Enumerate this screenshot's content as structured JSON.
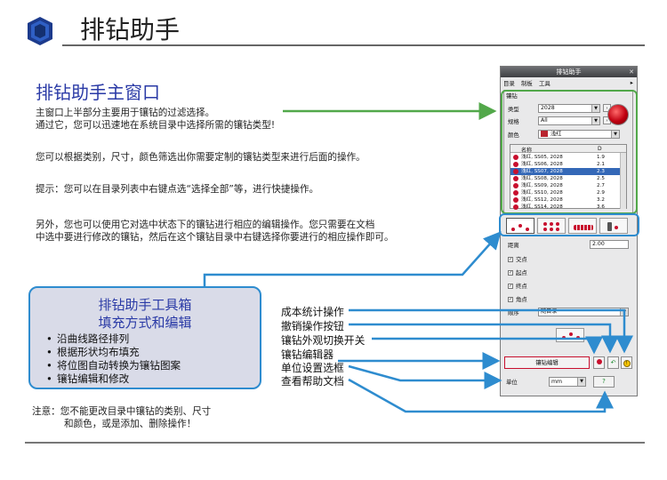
{
  "slide": {
    "title": "排钻助手",
    "section_heading": "排钻助手主窗口",
    "para1_line1": "主窗口上半部分主要用于镶钻的过滤选择。",
    "para1_line2": "通过它，您可以迅速地在系统目录中选择所需的镶钻类型!",
    "para2": "您可以根据类别，尺寸，颜色筛选出你需要定制的镶钻类型来进行后面的操作。",
    "para3": "提示：您可以在目录列表中右键点选“选择全部”等，进行快捷操作。",
    "para4_line1": "另外，您也可以使用它对选中状态下的镶钻进行相应的编辑操作。您只需要在文档",
    "para4_line2": "中选中要进行修改的镶钻，然后在这个镶钻目录中右键选择你要进行的相应操作即可。",
    "note_line1": "注意：您不能更改目录中镶钻的类别、尺寸",
    "note_line2": "和颜色，或是添加、删除操作！"
  },
  "toolbox": {
    "title1": "排钻助手工具箱",
    "title2": "填充方式和编辑",
    "items": [
      "沿曲线路径排列",
      "根据形状均布填充",
      "将位图自动转换为镶钻图案",
      "镶钻编辑和修改"
    ]
  },
  "callouts": [
    "成本统计操作",
    "撤销操作按钮",
    "镶钻外观切换开关",
    "镶钻编辑器",
    "单位设置选框",
    "查看帮助文档"
  ],
  "colors": {
    "accent_blue": "#2a3aa6",
    "arrow_blue": "#2e8ccf",
    "arrow_green": "#52a84a",
    "gem_red": "#c8102e"
  },
  "panel": {
    "title": "排钻助手",
    "close": "✕",
    "menu": [
      "目录",
      "制板",
      "工具"
    ],
    "menu_dropdown": "▸",
    "group_label": "镶钻",
    "category_label": "类型",
    "category_value": "2028",
    "size_label": "规格",
    "size_value": "All",
    "color_label": "颜色",
    "color_value": "浅红",
    "list_header_name": "名称",
    "list_header_d": "D",
    "rows": [
      {
        "name": "浅红, SS05, 2028",
        "d": "1.9"
      },
      {
        "name": "浅红, SS06, 2028",
        "d": "2.1"
      },
      {
        "name": "浅红, SS07, 2028",
        "d": "2.3"
      },
      {
        "name": "浅红, SS08, 2028",
        "d": "2.5"
      },
      {
        "name": "浅红, SS09, 2028",
        "d": "2.7"
      },
      {
        "name": "浅红, SS10, 2028",
        "d": "2.9"
      },
      {
        "name": "浅红, SS12, 2028",
        "d": "3.2"
      },
      {
        "name": "浅红, SS14, 2028",
        "d": "3.6"
      }
    ],
    "selected_row": 2,
    "spacing_label": "距离",
    "spacing_value": "2.00",
    "checks": [
      "交点",
      "起点",
      "终点",
      "角点"
    ],
    "order_label": "顺序",
    "order_value": "随目录",
    "edit_button": "镶钻编辑",
    "unit_label": "单位",
    "unit_value": "mm",
    "help_button": "?",
    "stat_icon": "stat-icon",
    "undo_icon": "undo-icon"
  }
}
